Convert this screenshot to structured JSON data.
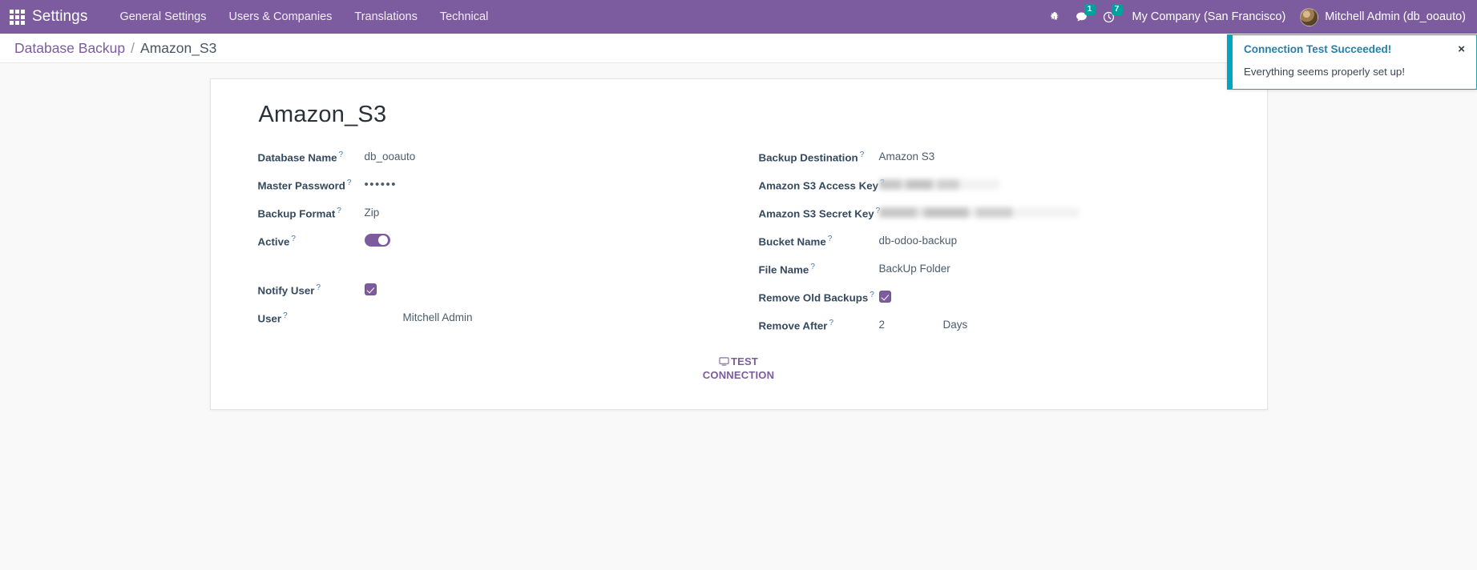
{
  "navbar": {
    "apps_icon": "apps-grid-icon",
    "brand": "Settings",
    "menus": [
      {
        "label": "General Settings"
      },
      {
        "label": "Users & Companies"
      },
      {
        "label": "Translations"
      },
      {
        "label": "Technical"
      }
    ],
    "bug_icon": "bug-icon",
    "messages_icon": "messages-icon",
    "messages_count": "1",
    "activities_icon": "clock-icon",
    "activities_count": "7",
    "company": "My Company (San Francisco)",
    "user": "Mitchell Admin (db_ooauto)",
    "avatar": "user-avatar",
    "accent_color": "#7c5c9e",
    "badge_color": "#00a09d"
  },
  "breadcrumb": {
    "parent": "Database Backup",
    "separator": "/",
    "current": "Amazon_S3"
  },
  "record": {
    "title": "Amazon_S3",
    "help_marker": "?"
  },
  "form": {
    "left": [
      {
        "label": "Database Name",
        "value": "db_ooauto",
        "type": "text"
      },
      {
        "label": "Master Password",
        "value": "••••••",
        "type": "password"
      },
      {
        "label": "Backup Format",
        "value": "Zip",
        "type": "text"
      },
      {
        "label": "Active",
        "value": "on",
        "type": "toggle"
      },
      {
        "label": "Notify User",
        "value": "checked",
        "type": "checkbox"
      },
      {
        "label": "User",
        "value": "Mitchell Admin",
        "type": "text"
      }
    ],
    "right": [
      {
        "label": "Backup Destination",
        "value": "Amazon S3",
        "type": "text"
      },
      {
        "label": "Amazon S3 Access Key",
        "value": "",
        "type": "redacted"
      },
      {
        "label": "Amazon S3 Secret Key",
        "value": "",
        "type": "redacted"
      },
      {
        "label": "Bucket Name",
        "value": "db-odoo-backup",
        "type": "text"
      },
      {
        "label": "File Name",
        "value": "BackUp Folder",
        "type": "text"
      },
      {
        "label": "Remove Old Backups",
        "value": "checked",
        "type": "checkbox"
      },
      {
        "label": "Remove After",
        "value": "2",
        "unit": "Days",
        "type": "number"
      }
    ],
    "test_button": {
      "label": "TEST CONNECTION",
      "icon": "monitor-icon"
    }
  },
  "toast": {
    "title": "Connection Test Succeeded!",
    "body": "Everything seems properly set up!",
    "close_label": "×",
    "accent_color": "#00a6bd",
    "title_color": "#2a7fa8"
  }
}
